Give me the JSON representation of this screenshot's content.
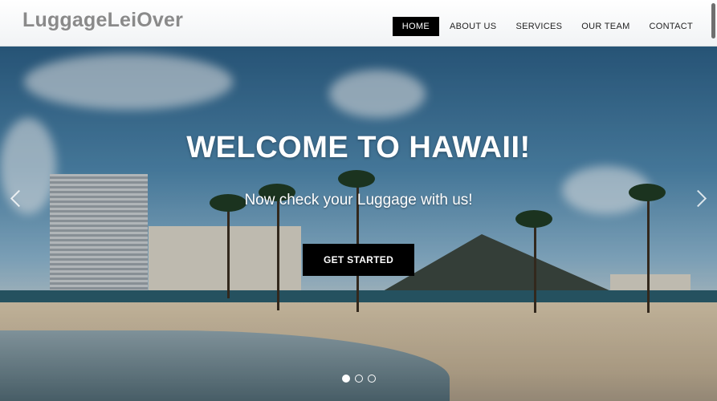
{
  "header": {
    "logo": "LuggageLeiOver",
    "nav": [
      "HOME",
      "ABOUT US",
      "SERVICES",
      "OUR TEAM",
      "CONTACT"
    ],
    "active_nav": "HOME"
  },
  "hero": {
    "title": "WELCOME TO HAWAII!",
    "subtitle": "Now check your Luggage with us!",
    "cta_label": "GET STARTED",
    "slides": 3,
    "active_slide": 1
  },
  "colors": {
    "nav_active_bg": "#000000",
    "logo": "#8a8a8a",
    "cta_bg": "#000000"
  },
  "icons": [
    "chevron-left-icon",
    "chevron-right-icon"
  ]
}
